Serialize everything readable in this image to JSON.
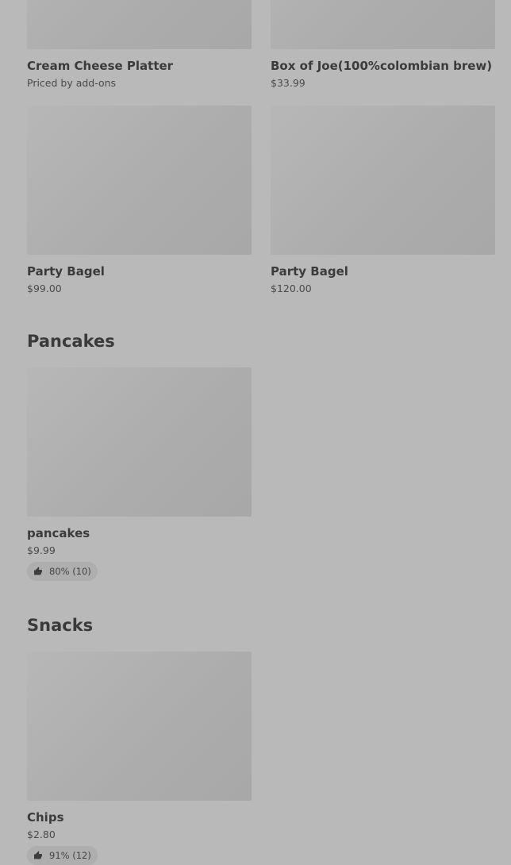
{
  "sections": {
    "top_row": [
      {
        "name": "Cream Cheese Platter",
        "price": "Priced by add-ons"
      },
      {
        "name": "Box of Joe(100%colombian brew)",
        "price": "$33.99"
      }
    ],
    "second_row": [
      {
        "name": "Party Bagel",
        "price": "$99.00"
      },
      {
        "name": "Party Bagel",
        "price": "$120.00"
      }
    ],
    "pancakes": {
      "title": "Pancakes",
      "items": [
        {
          "name": "pancakes",
          "price": "$9.99",
          "rating": "80% (10)"
        }
      ]
    },
    "snacks": {
      "title": "Snacks",
      "items": [
        {
          "name": "Chips",
          "price": "$2.80",
          "rating": "91% (12)"
        }
      ]
    }
  },
  "icons": {
    "rating_icon": "thumbs-up-icon"
  },
  "colors": {
    "overlay_background": "#b9b9b9",
    "image_placeholder": "#acacac",
    "text": "#3b3b3b"
  }
}
